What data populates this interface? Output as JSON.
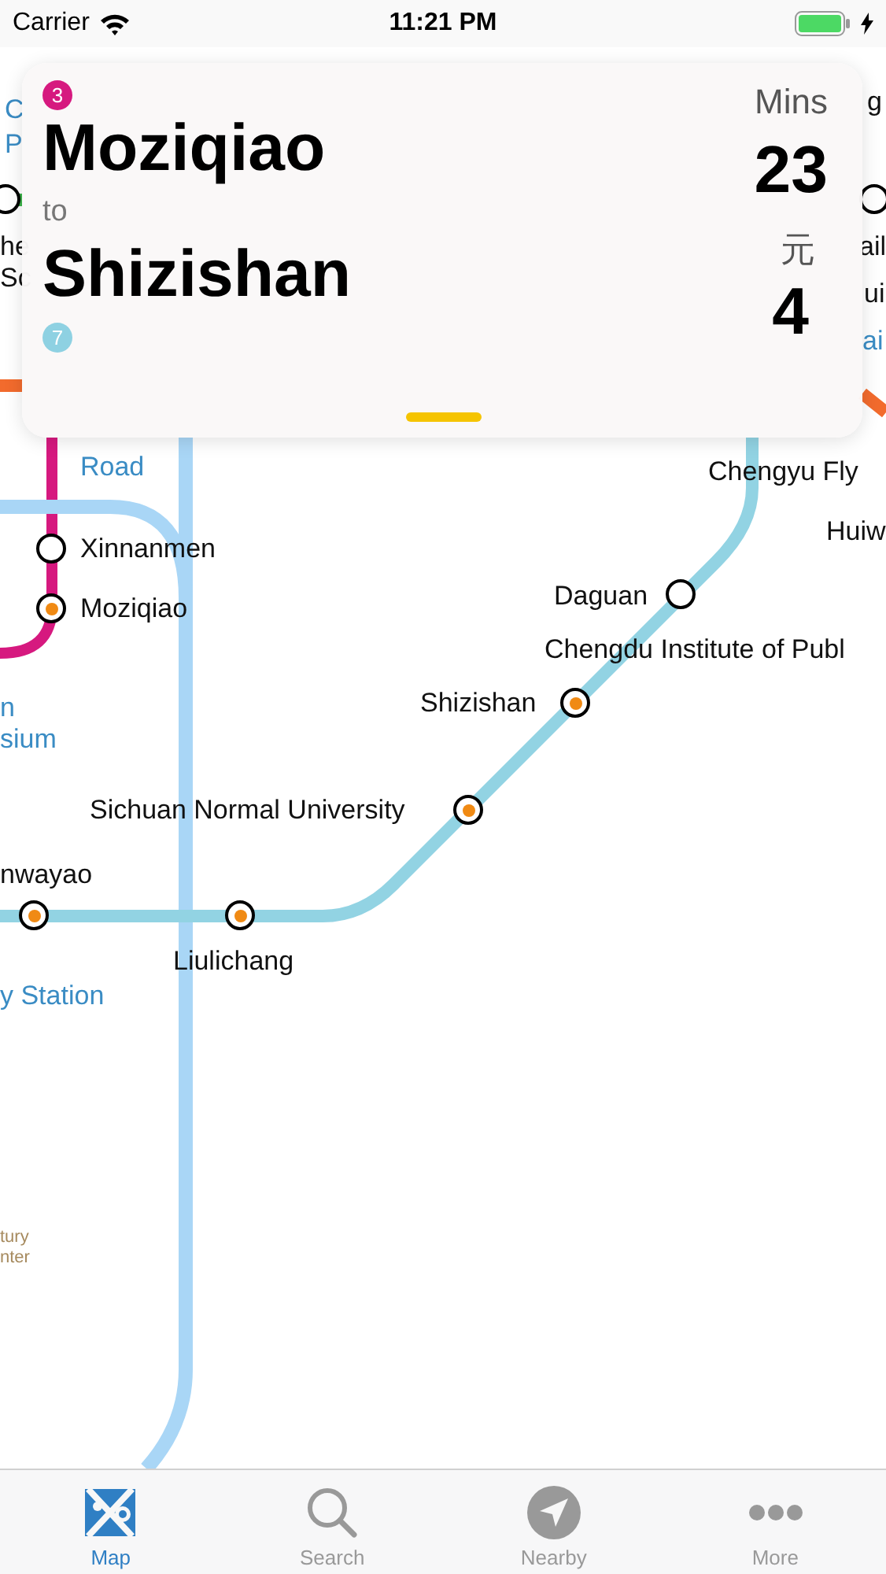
{
  "status_bar": {
    "carrier": "Carrier",
    "time": "11:21 PM"
  },
  "route_card": {
    "from_line": {
      "label": "3",
      "color": "#d6197f"
    },
    "from": "Moziqiao",
    "connector": "to",
    "to": "Shizishan",
    "to_line": {
      "label": "7",
      "color": "#8ed1e2"
    },
    "time_unit": "Mins",
    "time": "23",
    "fare_unit": "元",
    "fare": "4"
  },
  "map": {
    "labels": [
      {
        "text": "C",
        "kind": "area"
      },
      {
        "text": "P",
        "kind": "area"
      },
      {
        "text": "he",
        "kind": "station"
      },
      {
        "text": "Sc",
        "kind": "station"
      },
      {
        "text": "g",
        "kind": "station"
      },
      {
        "text": "ail",
        "kind": "station"
      },
      {
        "text": "ui",
        "kind": "station"
      },
      {
        "text": "ai",
        "kind": "area"
      },
      {
        "text": "Road",
        "kind": "area"
      },
      {
        "text": "Chengyu Fly",
        "kind": "station"
      },
      {
        "text": "Xinnanmen",
        "kind": "station"
      },
      {
        "text": "Huiw",
        "kind": "station"
      },
      {
        "text": "Moziqiao",
        "kind": "station"
      },
      {
        "text": "Daguan",
        "kind": "station"
      },
      {
        "text": "Chengdu Institute of Publ",
        "kind": "station"
      },
      {
        "text": "Shizishan",
        "kind": "station"
      },
      {
        "text": "n",
        "kind": "area"
      },
      {
        "text": "sium",
        "kind": "area"
      },
      {
        "text": "Sichuan Normal University",
        "kind": "station"
      },
      {
        "text": "nwayao",
        "kind": "station"
      },
      {
        "text": "Liulichang",
        "kind": "station"
      },
      {
        "text": "y Station",
        "kind": "area"
      },
      {
        "text": "tury",
        "kind": "landmark"
      },
      {
        "text": "nter",
        "kind": "landmark"
      }
    ],
    "stations": [
      {
        "transfer": false
      },
      {
        "transfer": false
      },
      {
        "transfer": false
      },
      {
        "transfer": true
      },
      {
        "transfer": false
      },
      {
        "transfer": true
      },
      {
        "transfer": true
      },
      {
        "transfer": true
      },
      {
        "transfer": true
      }
    ]
  },
  "tabs": [
    {
      "label": "Map",
      "selected": true
    },
    {
      "label": "Search",
      "selected": false
    },
    {
      "label": "Nearby",
      "selected": false
    },
    {
      "label": "More",
      "selected": false
    }
  ]
}
